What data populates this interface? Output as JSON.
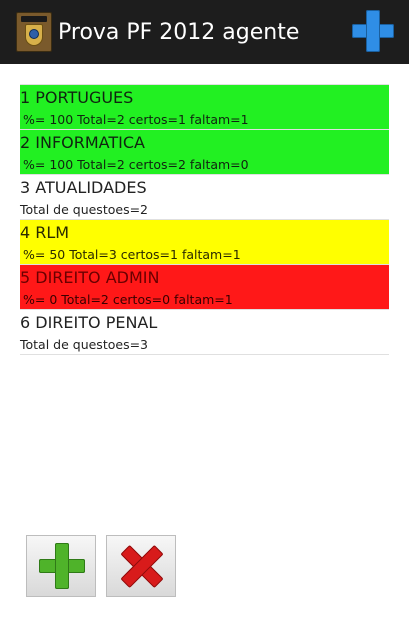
{
  "app": {
    "title": "Prova PF 2012 agente",
    "icon": "police-badge-icon",
    "add_icon": "plus-icon"
  },
  "subjects": [
    {
      "name": "1 PORTUGUES",
      "stats": "%= 100 Total=2 certos=1  faltam=1",
      "color": "#22f022"
    },
    {
      "name": "2 INFORMATICA",
      "stats": "%= 100 Total=2 certos=2  faltam=0",
      "color": "#22f022"
    },
    {
      "name": "3 ATUALIDADES",
      "stats": "Total de questoes=2",
      "color": "#ffffff"
    },
    {
      "name": "4 RLM",
      "stats": "%= 50 Total=3 certos=1  faltam=1",
      "color": "#ffff00"
    },
    {
      "name": "5 DIREITO ADMIN",
      "stats": "%= 0 Total=2 certos=0  faltam=1",
      "color": "#ff1818"
    },
    {
      "name": "6 DIREITO PENAL",
      "stats": "Total de questoes=3",
      "color": "#ffffff"
    }
  ],
  "buttons": {
    "add_icon": "green-plus-icon",
    "delete_icon": "red-x-icon"
  }
}
